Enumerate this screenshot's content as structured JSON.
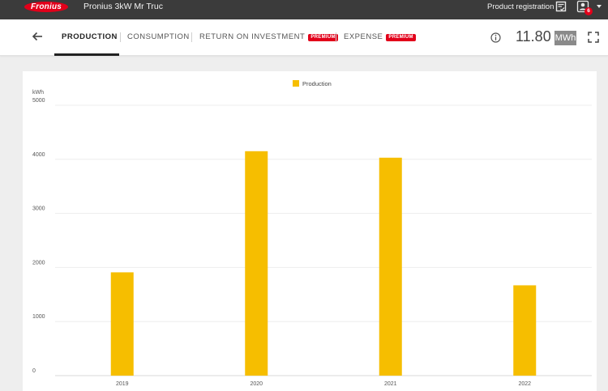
{
  "header": {
    "logo_text": "Fronius",
    "system_name": "Pronius 3kW Mr Truc",
    "product_registration": "Product registration",
    "notification_count": "6"
  },
  "nav": {
    "tabs": [
      {
        "label": "PRODUCTION",
        "active": true,
        "premium": false
      },
      {
        "label": "CONSUMPTION",
        "active": false,
        "premium": false
      },
      {
        "label": "RETURN ON INVESTMENT",
        "active": false,
        "premium": true
      },
      {
        "label": "EXPENSE",
        "active": false,
        "premium": true
      }
    ],
    "premium_label": "PREMIUM",
    "total_value": "11.80",
    "total_unit": "MWh"
  },
  "colors": {
    "bar": "#f6be00",
    "brand_red": "#e2001a"
  },
  "chart_data": {
    "type": "bar",
    "categories": [
      "2019",
      "2020",
      "2021",
      "2022"
    ],
    "series": [
      {
        "name": "Production",
        "values": [
          1910,
          4150,
          4030,
          1670
        ]
      }
    ],
    "ylabel": "kWh",
    "ylim": [
      0,
      5000
    ],
    "yticks": [
      0,
      1000,
      2000,
      3000,
      4000,
      5000
    ],
    "legend": "top-center",
    "grid": true
  }
}
